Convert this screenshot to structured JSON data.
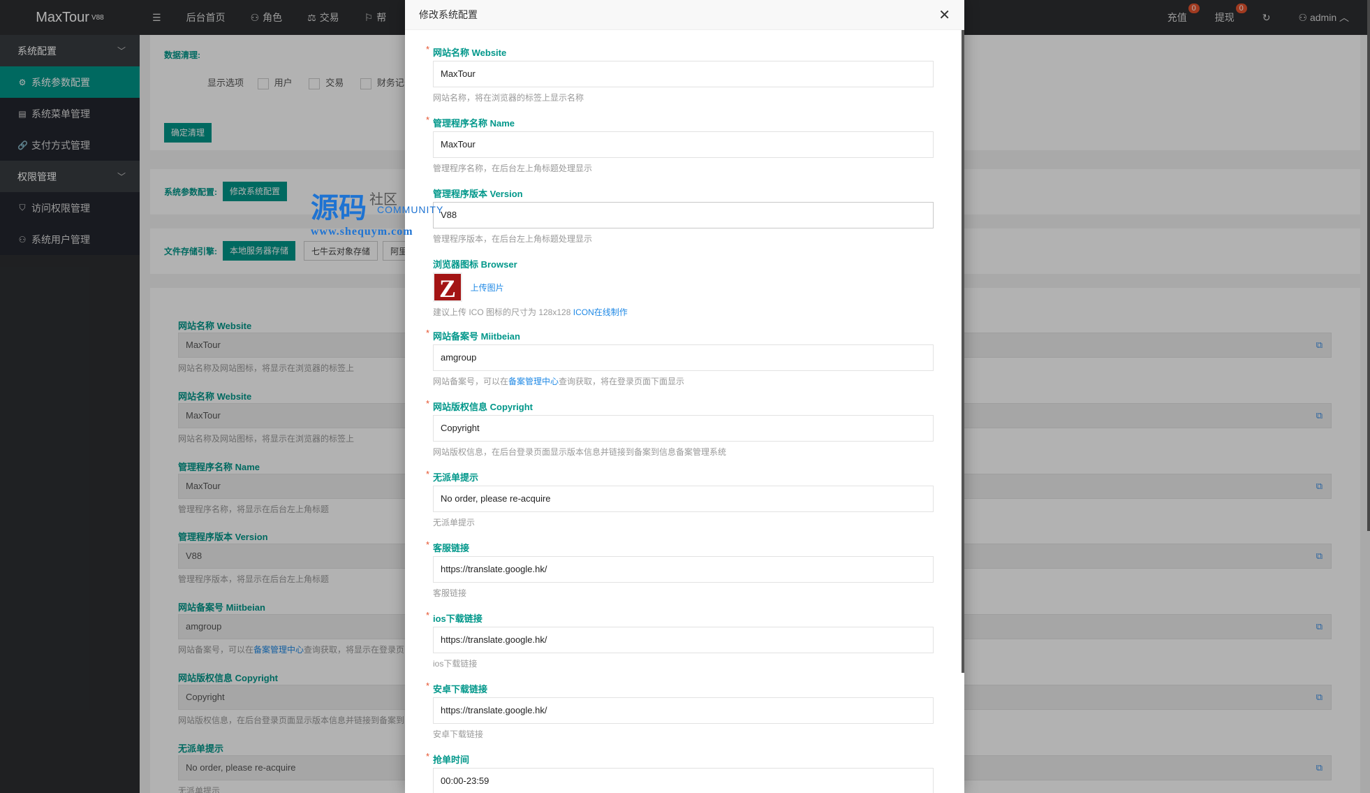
{
  "app": {
    "name": "MaxTour",
    "version": "V88"
  },
  "sidebar": {
    "groups": [
      {
        "label": "系统配置",
        "items": [
          {
            "label": "系统参数配置",
            "icon": "gear-icon",
            "active": true
          },
          {
            "label": "系统菜单管理",
            "icon": "menu-icon"
          },
          {
            "label": "支付方式管理",
            "icon": "link-icon"
          }
        ]
      },
      {
        "label": "权限管理",
        "items": [
          {
            "label": "访问权限管理",
            "icon": "shield-icon"
          },
          {
            "label": "系统用户管理",
            "icon": "user-icon"
          }
        ]
      }
    ]
  },
  "header": {
    "nav": [
      {
        "label": "后台首页"
      },
      {
        "label": "角色"
      },
      {
        "label": "交易"
      },
      {
        "label": "帮"
      }
    ],
    "recharge": {
      "label": "充值",
      "badge": "0"
    },
    "withdraw": {
      "label": "提现",
      "badge": "0"
    },
    "user": "admin"
  },
  "bg": {
    "clean_label": "数据清理:",
    "display_label": "显示选项",
    "opt_user": "用户",
    "opt_trade": "交易",
    "opt_finance": "财务记录",
    "confirm_clean": "确定清理",
    "sys_cfg_label": "系统参数配置:",
    "edit_cfg_btn": "修改系统配置",
    "storage_label": "文件存储引擎:",
    "storage_local": "本地服务器存储",
    "storage_qiniu": "七牛云对象存储",
    "storage_ali": "阿里",
    "fields": [
      {
        "label": "网站名称 Website",
        "value": "MaxTour",
        "help": "网站名称及网站图标，将显示在浏览器的标签上"
      },
      {
        "label": "网站名称 Website",
        "value": "MaxTour",
        "help": "网站名称及网站图标，将显示在浏览器的标签上"
      },
      {
        "label": "管理程序名称 Name",
        "value": "MaxTour",
        "help": "管理程序名称，将显示在后台左上角标题"
      },
      {
        "label": "管理程序版本 Version",
        "value": "V88",
        "help": "管理程序版本，将显示在后台左上角标题"
      },
      {
        "label": "网站备案号 Miitbeian",
        "value": "amgroup",
        "help_pre": "网站备案号，可以在",
        "help_link": "备案管理中心",
        "help_post": "查询获取，将显示在登录页"
      },
      {
        "label": "网站版权信息 Copyright",
        "value": "Copyright",
        "help": "网站版权信息，在后台登录页面显示版本信息并链接到备案到"
      },
      {
        "label": "无派单提示",
        "value": "No order, please re-acquire",
        "help": "无派单提示"
      }
    ]
  },
  "watermark": {
    "cn": "源码",
    "cn2": "社区",
    "en": "COMMUNITY",
    "url": "www.shequym.com"
  },
  "modal": {
    "title": "修改系统配置",
    "fields": [
      {
        "label": "网站名称 Website",
        "value": "MaxTour",
        "help": "网站名称，将在浏览器的标签上显示名称"
      },
      {
        "label": "管理程序名称 Name",
        "value": "MaxTour",
        "help": "管理程序名称，在后台左上角标题处理显示"
      },
      {
        "label": "管理程序版本 Version",
        "value": "V88",
        "help": "管理程序版本，在后台左上角标题处理显示"
      },
      {
        "label": "网站备案号 Miitbeian",
        "value": "amgroup",
        "help_pre": "网站备案号，可以在",
        "help_link": "备案管理中心",
        "help_post": "查询获取，将在登录页面下面显示"
      },
      {
        "label": "网站版权信息 Copyright",
        "value": "Copyright",
        "help": "网站版权信息，在后台登录页面显示版本信息并链接到备案到信息备案管理系统"
      },
      {
        "label": "无派单提示",
        "value": "No order, please re-acquire",
        "help": "无派单提示"
      },
      {
        "label": "客服链接",
        "value": "https://translate.google.hk/",
        "help": "客服链接"
      },
      {
        "label": "ios下载链接",
        "value": "https://translate.google.hk/",
        "help": "ios下载链接"
      },
      {
        "label": "安卓下载链接",
        "value": "https://translate.google.hk/",
        "help": "安卓下载链接"
      },
      {
        "label": "抢单时间",
        "value": "00:00-23:59"
      }
    ],
    "browser_icon": {
      "label": "浏览器图标 Browser",
      "letter": "Z",
      "upload": "上传图片",
      "help_pre": "建议上传 ICO 图标的尺寸为 128x128",
      "help_link": "ICON在线制作"
    }
  }
}
